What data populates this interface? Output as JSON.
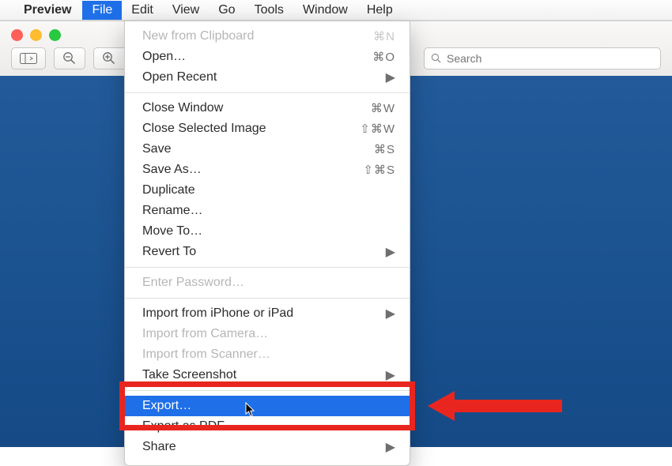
{
  "menubar": {
    "app": "Preview",
    "items": [
      "File",
      "Edit",
      "View",
      "Go",
      "Tools",
      "Window",
      "Help"
    ],
    "active_index": 0
  },
  "toolbar": {
    "sidebar_icon": "sidebar",
    "zoom_out_icon": "minus-magnifier",
    "zoom_in_icon": "plus-magnifier",
    "search_placeholder": "Search"
  },
  "file_menu": {
    "groups": [
      [
        {
          "label": "New from Clipboard",
          "shortcut": "⌘N",
          "enabled": false
        },
        {
          "label": "Open…",
          "shortcut": "⌘O",
          "enabled": true
        },
        {
          "label": "Open Recent",
          "submenu": true,
          "enabled": true
        }
      ],
      [
        {
          "label": "Close Window",
          "shortcut": "⌘W",
          "enabled": true
        },
        {
          "label": "Close Selected Image",
          "shortcut": "⇧⌘W",
          "enabled": true
        },
        {
          "label": "Save",
          "shortcut": "⌘S",
          "enabled": true
        },
        {
          "label": "Save As…",
          "shortcut": "⇧⌘S",
          "enabled": true
        },
        {
          "label": "Duplicate",
          "enabled": true
        },
        {
          "label": "Rename…",
          "enabled": true
        },
        {
          "label": "Move To…",
          "enabled": true
        },
        {
          "label": "Revert To",
          "submenu": true,
          "enabled": true
        }
      ],
      [
        {
          "label": "Enter Password…",
          "enabled": false
        }
      ],
      [
        {
          "label": "Import from iPhone or iPad",
          "submenu": true,
          "enabled": true
        },
        {
          "label": "Import from Camera…",
          "enabled": false
        },
        {
          "label": "Import from Scanner…",
          "enabled": false
        },
        {
          "label": "Take Screenshot",
          "submenu": true,
          "enabled": true
        }
      ],
      [
        {
          "label": "Export…",
          "enabled": true,
          "highlighted": true
        },
        {
          "label": "Export as PDF…",
          "enabled": true
        },
        {
          "label": "Share",
          "submenu": true,
          "enabled": true
        }
      ]
    ]
  },
  "annotation": {
    "target_label": "Export…"
  }
}
